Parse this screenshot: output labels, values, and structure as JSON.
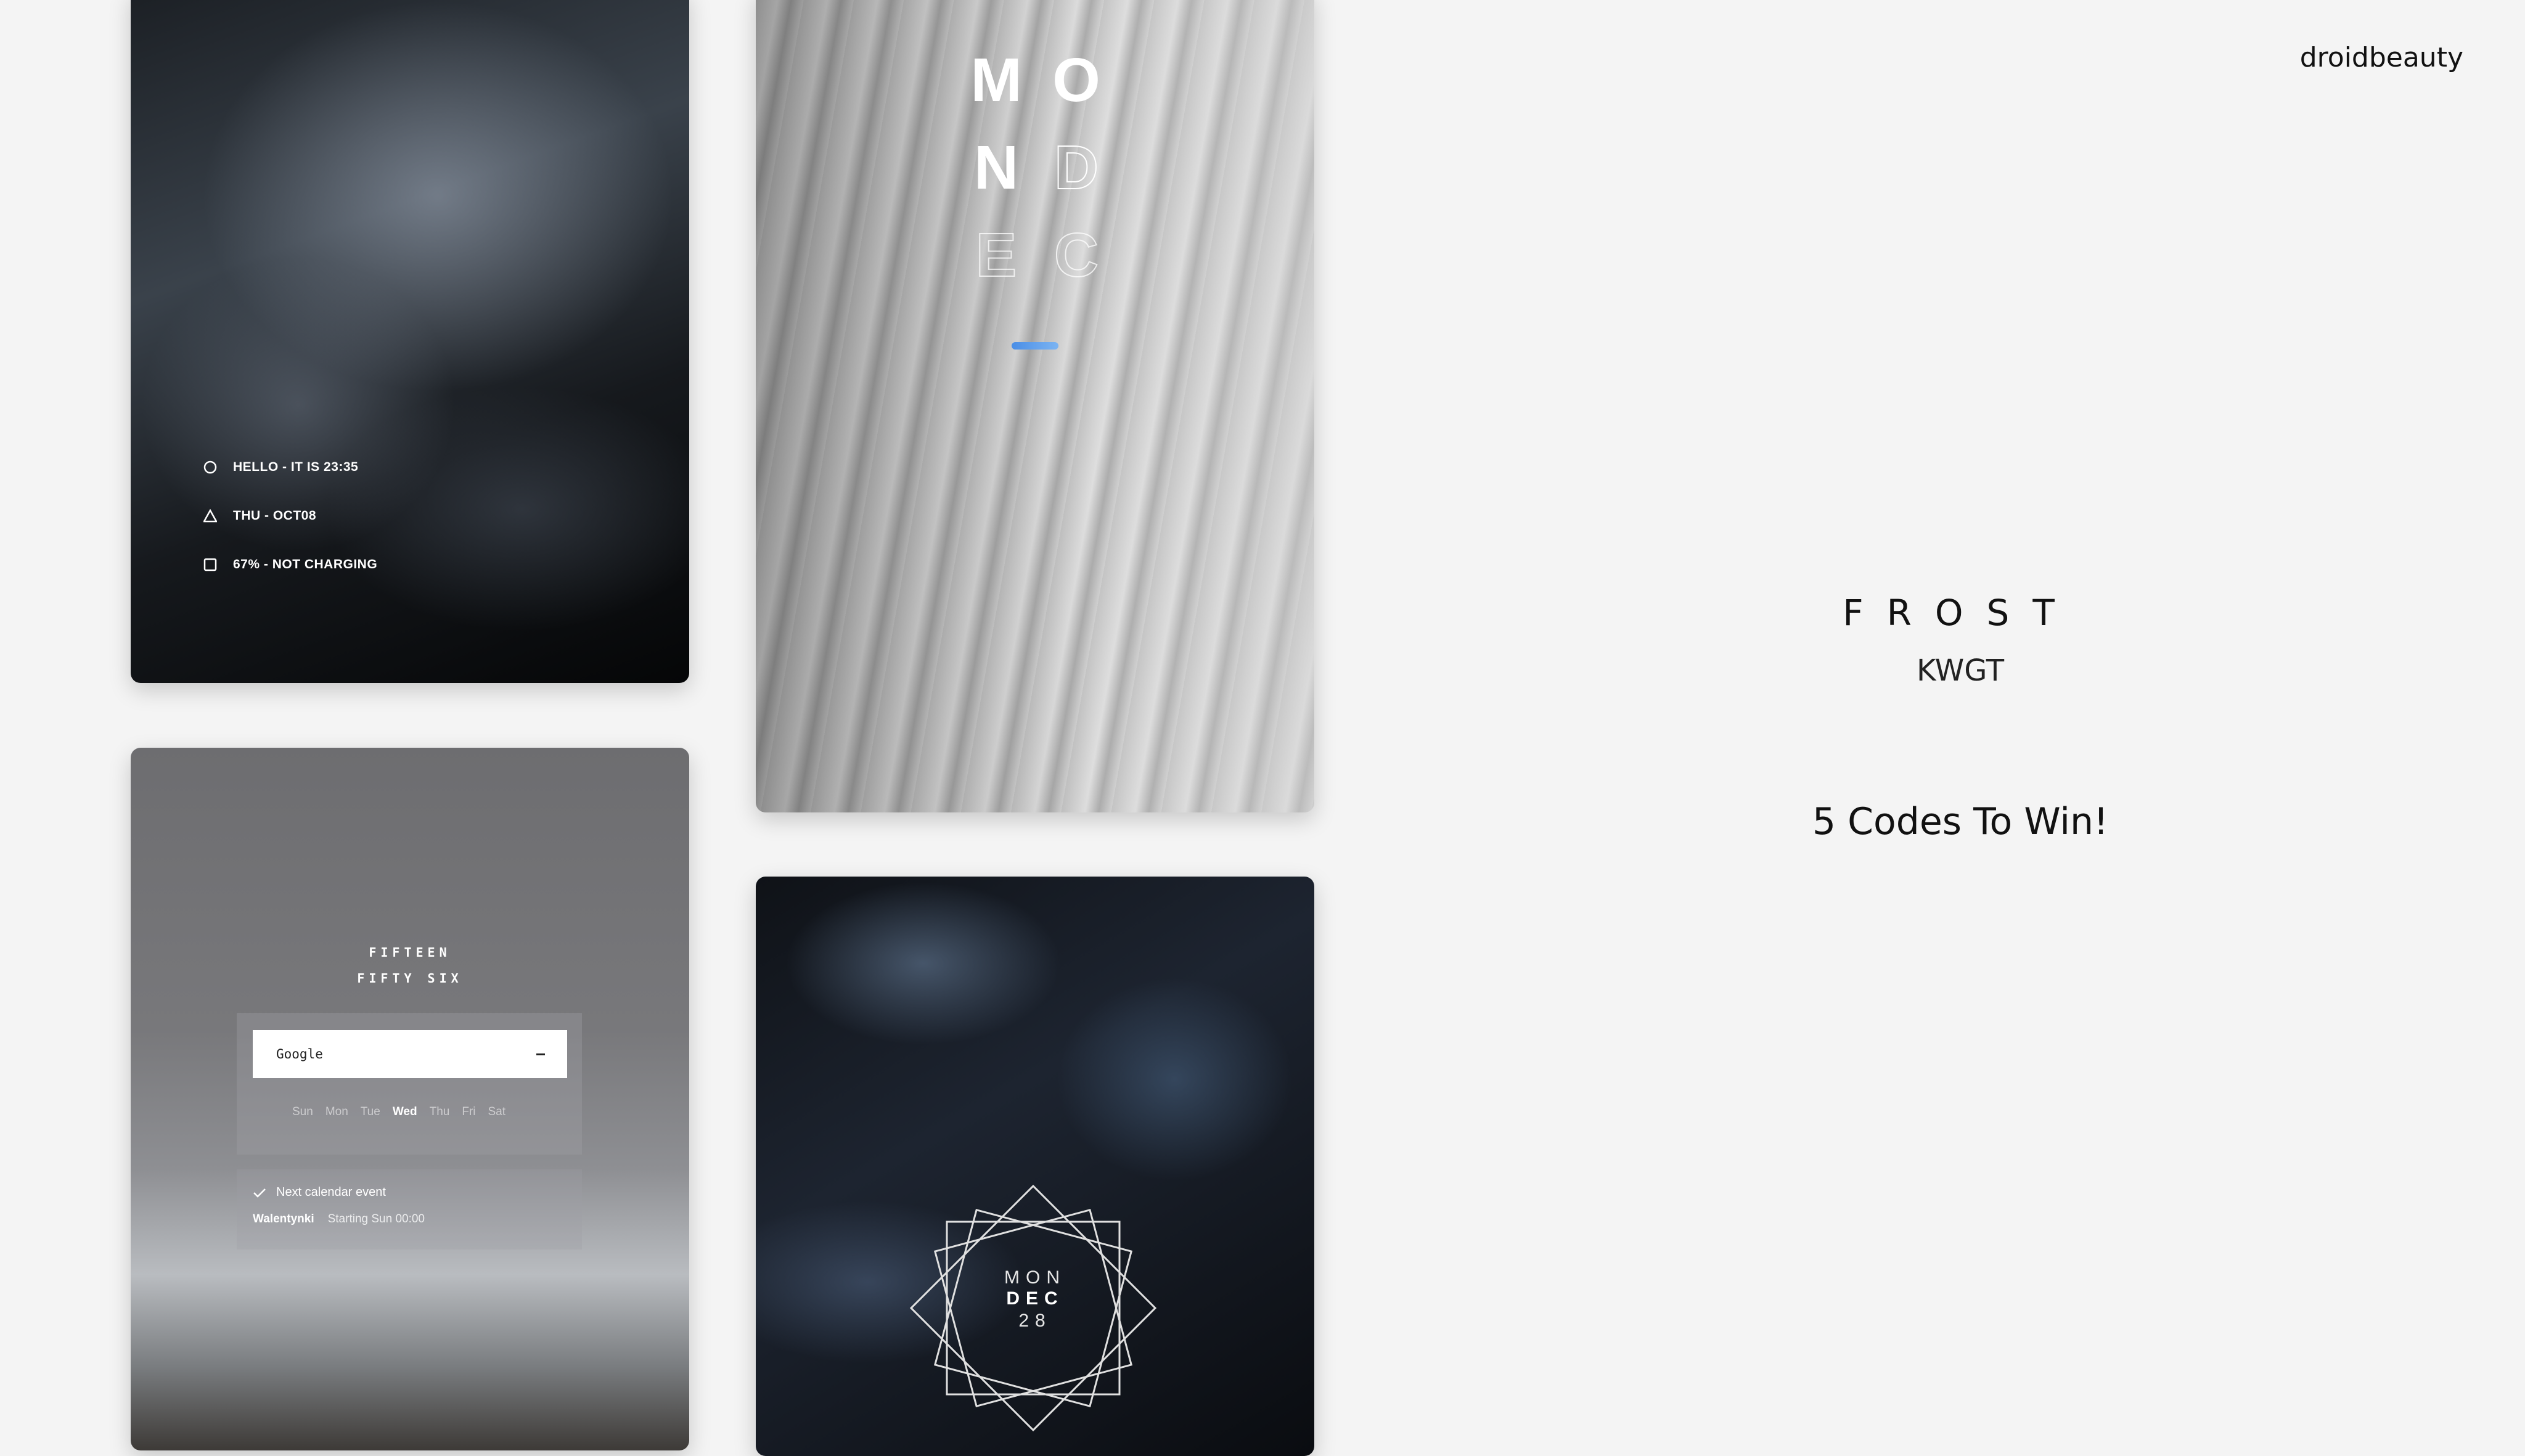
{
  "brand": "droidbeauty",
  "title": "FROST",
  "subtitle": "KWGT",
  "promo": "5 Codes To Win!",
  "ice_widget": {
    "rows": [
      {
        "icon": "circle-icon",
        "text": "HELLO - IT IS 23:35"
      },
      {
        "icon": "triangle-icon",
        "text": "THU - OCT08"
      },
      {
        "icon": "square-icon",
        "text": "67% - NOT CHARGING"
      }
    ]
  },
  "mondec_widget": {
    "letters": [
      "M",
      "O",
      "N",
      "D",
      "E",
      "C"
    ],
    "accent_color": "#4a8ee6"
  },
  "mountain_widget": {
    "time_line1": "FIFTEEN",
    "time_line2": "FIFTY SIX",
    "search_label": "Google",
    "days": [
      "Sun",
      "Mon",
      "Tue",
      "Wed",
      "Thu",
      "Fri",
      "Sat"
    ],
    "active_day": "Wed",
    "event_header": "Next calendar event",
    "event_name": "Walentynki",
    "event_time": "Starting Sun 00:00"
  },
  "marble_widget": {
    "day": "MON",
    "month": "DEC",
    "date": "28"
  }
}
